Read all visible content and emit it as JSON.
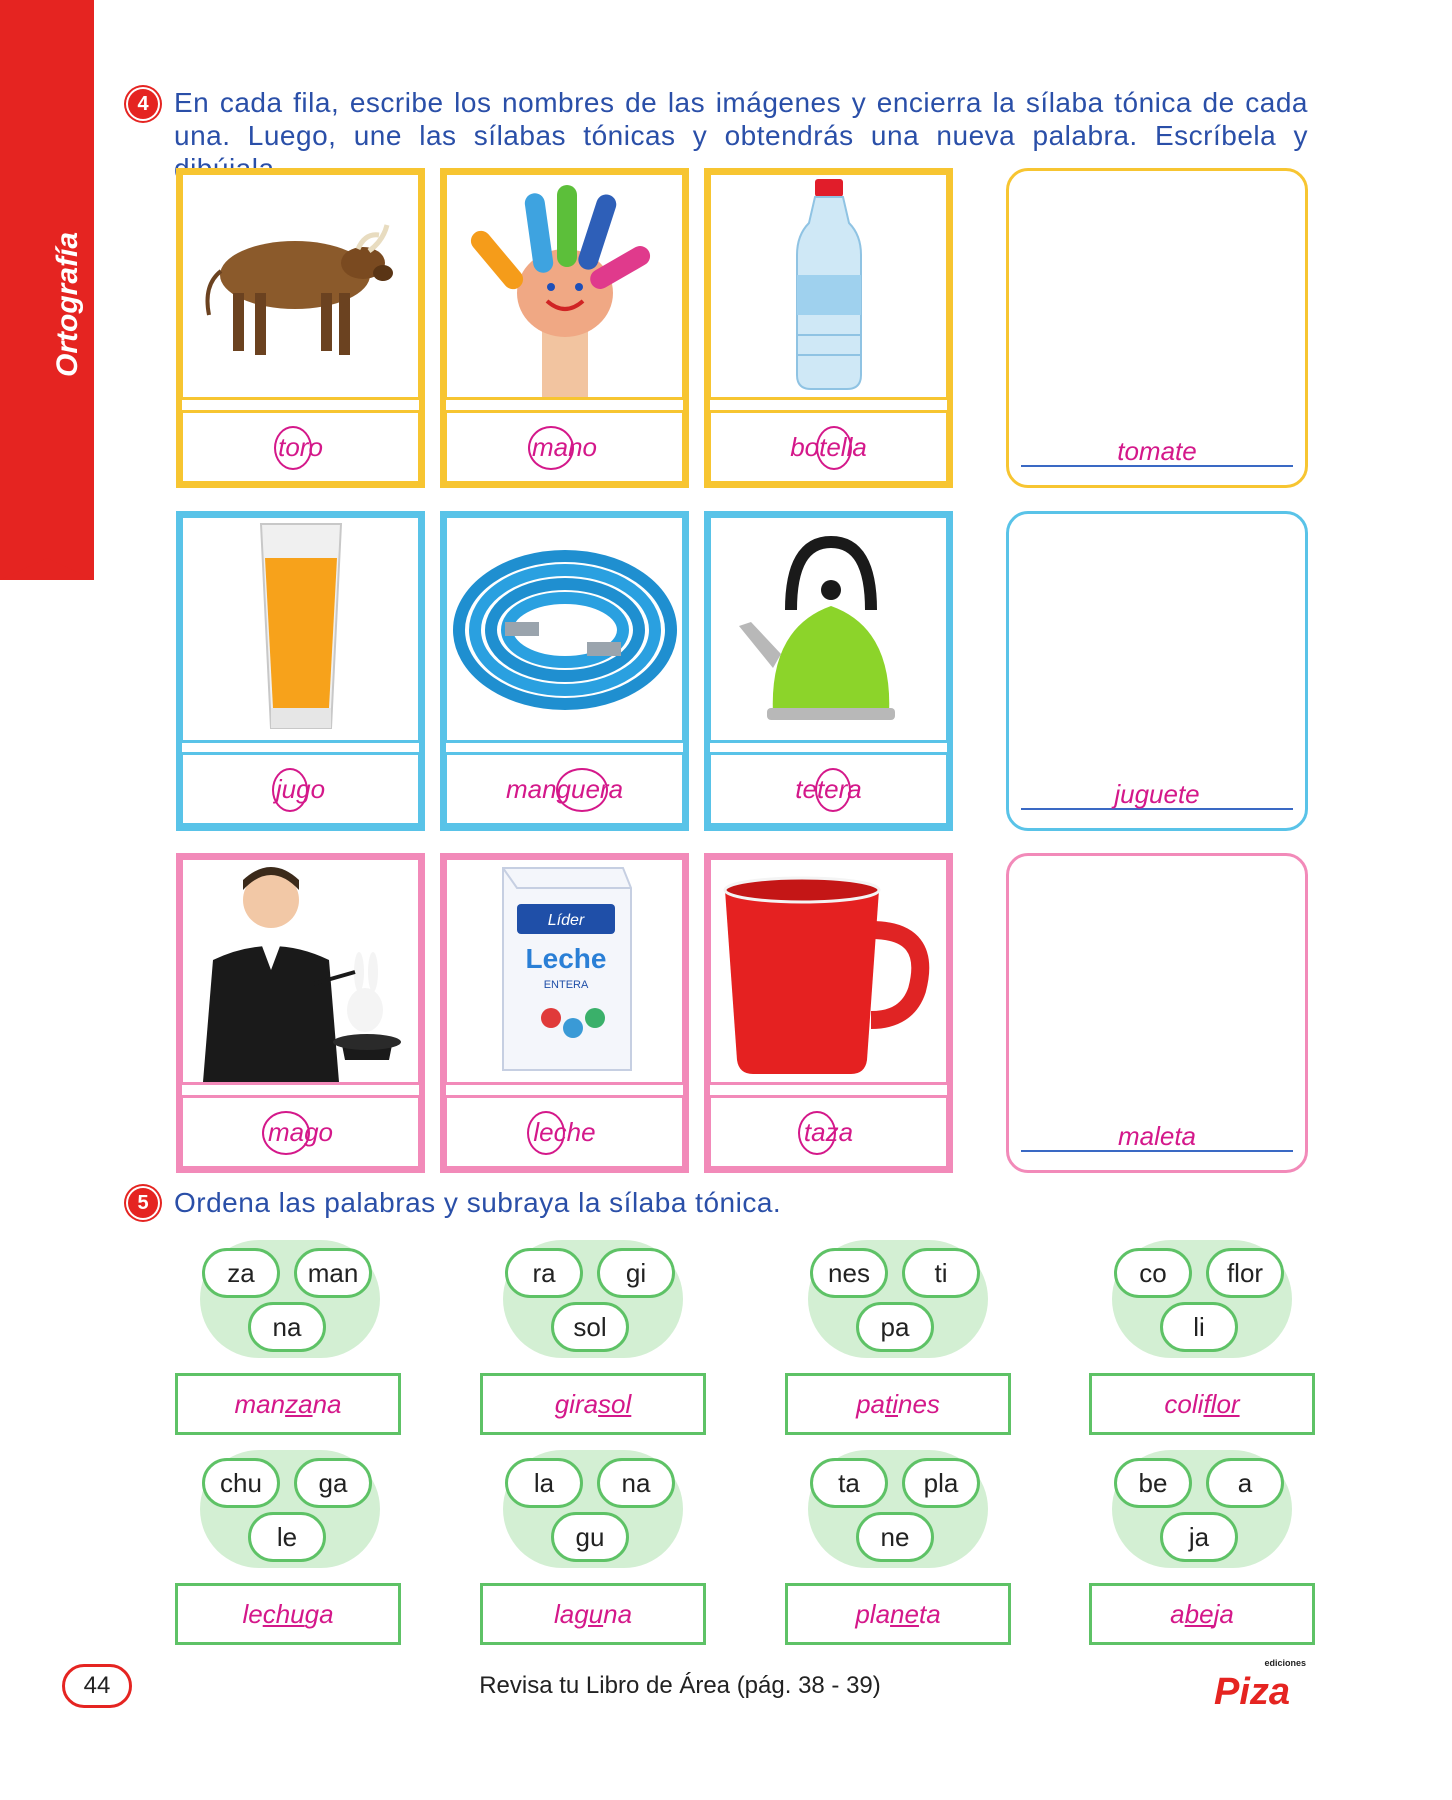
{
  "side_tab": {
    "label": "Ortografía",
    "color": "#e52421"
  },
  "exercise4": {
    "number": "4",
    "instruction": "En cada fila, escribe los nombres de las imágenes y encierra la sílaba tónica de cada una. Luego, une las sílabas tónicas y obtendrás una nueva palabra. Escríbela y dibújala.",
    "rows": [
      {
        "color": "#f7c531",
        "items": [
          {
            "image": "bull",
            "pre": "",
            "tonic": "to",
            "post": "ro"
          },
          {
            "image": "painted-hand",
            "pre": "",
            "tonic": "ma",
            "post": "no"
          },
          {
            "image": "water-bottle",
            "pre": "bo",
            "tonic": "te",
            "post": "lla"
          }
        ],
        "result": "tomate"
      },
      {
        "color": "#59c3e8",
        "items": [
          {
            "image": "juice-glass",
            "pre": "",
            "tonic": "ju",
            "post": "go"
          },
          {
            "image": "hose",
            "pre": "man",
            "tonic": "gue",
            "post": "ra"
          },
          {
            "image": "kettle",
            "pre": "te",
            "tonic": "te",
            "post": "ra"
          }
        ],
        "result": "juguete"
      },
      {
        "color": "#f28ab9",
        "items": [
          {
            "image": "magician",
            "pre": "",
            "tonic": "ma",
            "post": "go"
          },
          {
            "image": "milk-carton",
            "pre": "",
            "tonic": "le",
            "post": "che"
          },
          {
            "image": "red-mug",
            "pre": "",
            "tonic": "ta",
            "post": "za"
          }
        ],
        "result": "maleta"
      }
    ],
    "milk_brand": "Líder",
    "milk_label": "Leche",
    "milk_sub": "ENTERA"
  },
  "exercise5": {
    "number": "5",
    "instruction": "Ordena las palabras y subraya la sílaba tónica.",
    "groups": [
      {
        "syllables": [
          "za",
          "man",
          "na"
        ],
        "pre": "man",
        "tonic": "za",
        "post": "na"
      },
      {
        "syllables": [
          "ra",
          "gi",
          "sol"
        ],
        "pre": "gira",
        "tonic": "sol",
        "post": ""
      },
      {
        "syllables": [
          "nes",
          "ti",
          "pa"
        ],
        "pre": "pa",
        "tonic": "ti",
        "post": "nes"
      },
      {
        "syllables": [
          "co",
          "flor",
          "li"
        ],
        "pre": "coli",
        "tonic": "flor",
        "post": ""
      },
      {
        "syllables": [
          "chu",
          "ga",
          "le"
        ],
        "pre": "le",
        "tonic": "chu",
        "post": "ga"
      },
      {
        "syllables": [
          "la",
          "na",
          "gu"
        ],
        "pre": "la",
        "tonic": "gu",
        "post": "na"
      },
      {
        "syllables": [
          "ta",
          "pla",
          "ne"
        ],
        "pre": "pla",
        "tonic": "ne",
        "post": "ta"
      },
      {
        "syllables": [
          "be",
          "a",
          "ja"
        ],
        "pre": "a",
        "tonic": "be",
        "post": "ja"
      }
    ]
  },
  "footer": {
    "page_number": "44",
    "reference": "Revisa tu Libro de Área (pág. 38 - 39)",
    "logo_top": "ediciones",
    "logo": "Piza"
  }
}
